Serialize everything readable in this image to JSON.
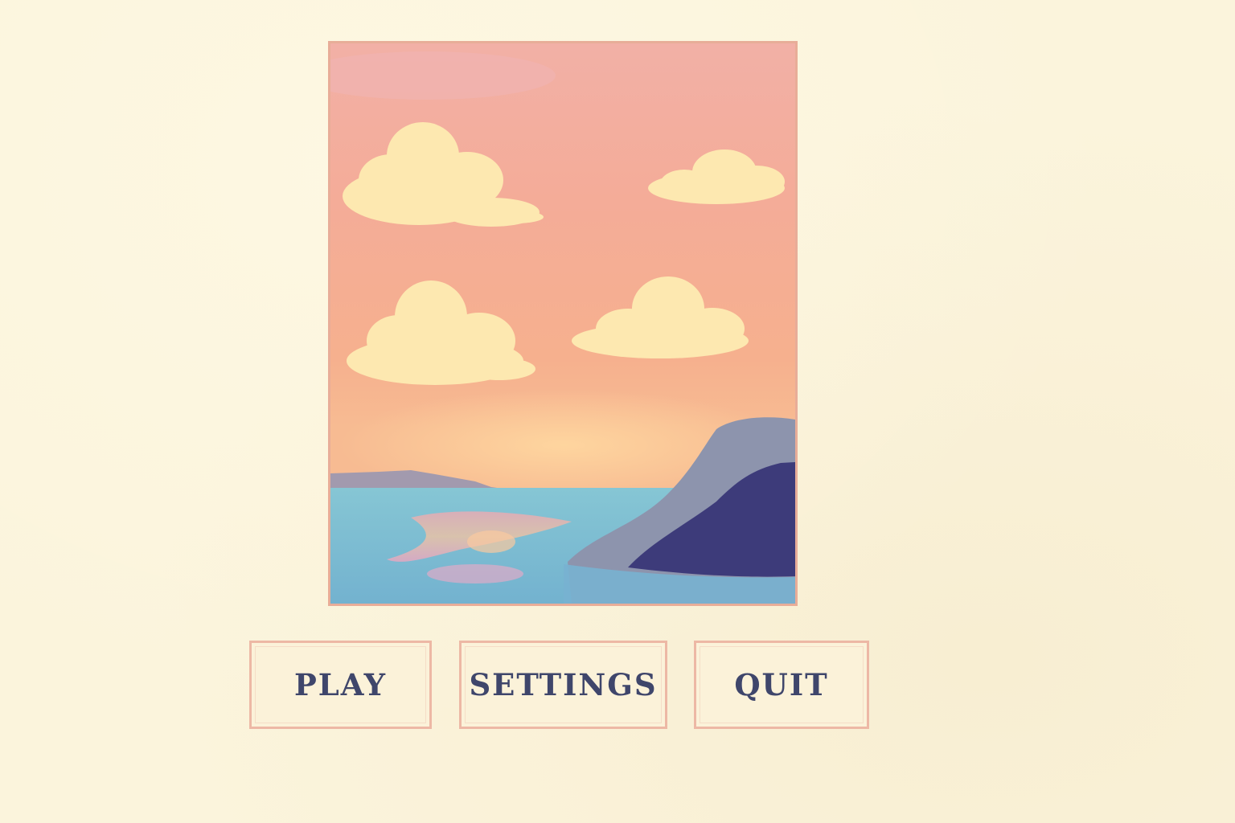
{
  "scene": {
    "artwork": "sunset-sea-painting",
    "colors": {
      "background": "#fbf4dc",
      "frame_border": "#e8ad98",
      "sky": "#f4b49c",
      "cloud": "#fde9b2",
      "sea": "#7fc0cf",
      "island_far": "#8a91aa",
      "island_near": "#3a3a78",
      "button_text": "#3f466b",
      "button_border": "#edb8a5"
    }
  },
  "menu": {
    "play_label": "PLAY",
    "settings_label": "SETTINGS",
    "quit_label": "QUIT"
  }
}
